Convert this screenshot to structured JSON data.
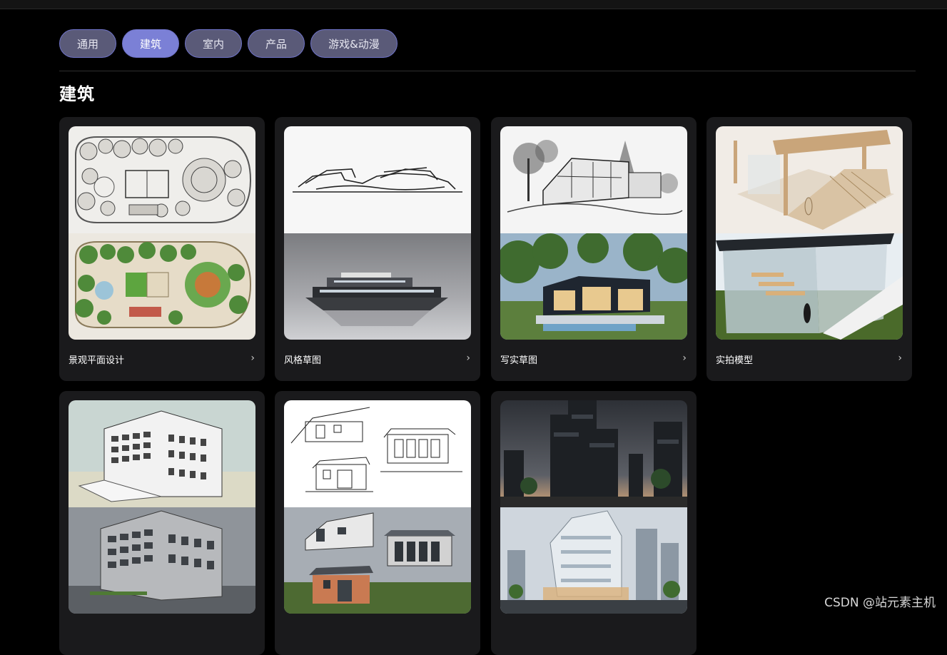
{
  "tabs": [
    {
      "label": "通用",
      "active": false
    },
    {
      "label": "建筑",
      "active": true
    },
    {
      "label": "室内",
      "active": false
    },
    {
      "label": "产品",
      "active": false
    },
    {
      "label": "游戏&动漫",
      "active": false
    }
  ],
  "section_title": "建筑",
  "cards": [
    {
      "label": "景观平面设计",
      "upper_image": "landscape-plan-sketch",
      "lower_image": "landscape-plan-color"
    },
    {
      "label": "风格草图",
      "upper_image": "style-sketch-lines",
      "lower_image": "style-render-building"
    },
    {
      "label": "写实草图",
      "upper_image": "realistic-sketch-house",
      "lower_image": "realistic-render-house"
    },
    {
      "label": "实拍模型",
      "upper_image": "physical-model-photo",
      "lower_image": "physical-model-render"
    },
    {
      "label": "",
      "upper_image": "building-massing-model",
      "lower_image": "building-render"
    },
    {
      "label": "",
      "upper_image": "elevation-line-drawings",
      "lower_image": "elevation-renders"
    },
    {
      "label": "",
      "upper_image": "city-towers-dusk",
      "lower_image": "city-tower-render"
    }
  ],
  "watermark": "CSDN @站元素主机",
  "colors": {
    "tab_bg": "#5a5a78",
    "tab_active_bg": "#7b80d6",
    "tab_border": "#6f73c9",
    "card_bg": "#1a1a1c",
    "page_bg": "#000000"
  }
}
